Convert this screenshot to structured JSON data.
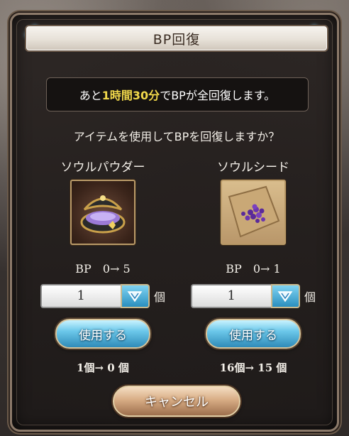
{
  "dialog": {
    "title": "BP回復",
    "info": {
      "prefix": "あと",
      "time": "1時間30分",
      "suffix": "でBPが全回復します。"
    },
    "question": "アイテムを使用してBPを回復しますか？",
    "items": [
      {
        "name": "ソウルパウダー",
        "icon": "soul-powder-icon",
        "bp": "BP　0→ 5",
        "quantity": "1",
        "unit": "個",
        "use_label": "使用する",
        "count": "1個→ 0 個"
      },
      {
        "name": "ソウルシード",
        "icon": "soul-seed-icon",
        "bp": "BP　0→ 1",
        "quantity": "1",
        "unit": "個",
        "use_label": "使用する",
        "count": "16個→ 15 個"
      }
    ],
    "cancel_label": "キャンセル"
  },
  "colors": {
    "highlight": "#f2d94b",
    "use_button": "#6cc8ea",
    "cancel_button": "#d8ad85"
  }
}
